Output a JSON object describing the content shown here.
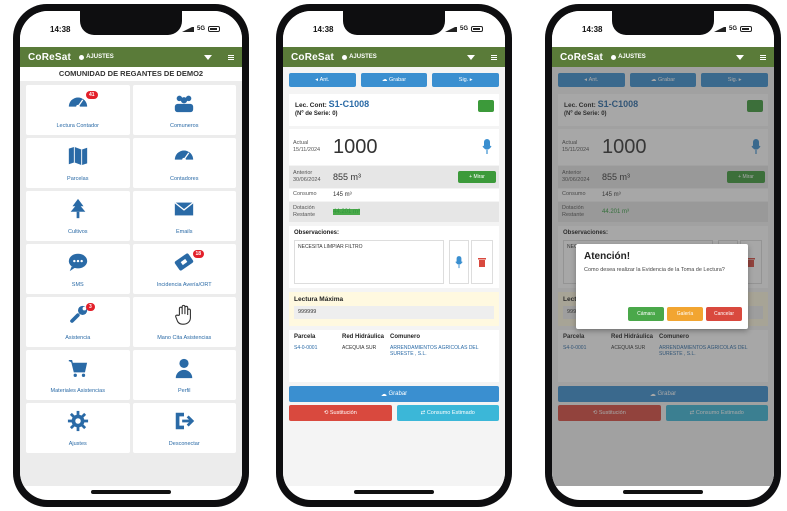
{
  "status": {
    "time": "14:38",
    "network": "5G"
  },
  "app": {
    "logo": "CoReSat",
    "settings_label": "AJUSTES"
  },
  "home": {
    "community": "COMUNIDAD DE REGANTES DE DEMO2",
    "tiles": [
      {
        "label": "Lectura Contador",
        "icon": "gauge-icon",
        "badge": "41"
      },
      {
        "label": "Comuneros",
        "icon": "people-icon",
        "badge": ""
      },
      {
        "label": "Parcelas",
        "icon": "map-icon",
        "badge": ""
      },
      {
        "label": "Contadores",
        "icon": "gauge-icon",
        "badge": ""
      },
      {
        "label": "Cultivos",
        "icon": "tree-icon",
        "badge": ""
      },
      {
        "label": "Emails",
        "icon": "envelope-icon",
        "badge": ""
      },
      {
        "label": "SMS",
        "icon": "chat-icon",
        "badge": ""
      },
      {
        "label": "Incidencia Avería/ORT",
        "icon": "ticket-icon",
        "badge": "18"
      },
      {
        "label": "Asistencia",
        "icon": "wrench-icon",
        "badge": "3"
      },
      {
        "label": "Mano Cita Asistencias",
        "icon": "hand-icon",
        "badge": ""
      },
      {
        "label": "Materiales Asistencias",
        "icon": "cart-icon",
        "badge": ""
      },
      {
        "label": "Perfil",
        "icon": "user-icon",
        "badge": ""
      },
      {
        "label": "Ajustes",
        "icon": "gear-icon",
        "badge": ""
      },
      {
        "label": "Desconectar",
        "icon": "logout-icon",
        "badge": ""
      }
    ]
  },
  "reading": {
    "tabs": {
      "prev": "Ant.",
      "save": "Grabar",
      "next": "Sig."
    },
    "counter_title": "Lec. Cont:",
    "counter_id": "S1-C1008",
    "serial": "(Nº de Serie: 0)",
    "current_label": "Actual",
    "current_date": "15/11/2024",
    "current_value": "1000",
    "previous_label": "Anterior",
    "previous_date": "30/06/2024",
    "previous_value": "855 m³",
    "more_button": "Mirar",
    "consumption_label": "Consumo",
    "consumption_value": "145 m³",
    "remaining_label": "Dotación Restante",
    "remaining_value": "44.201 m³",
    "obs_label": "Observaciones:",
    "obs_text": "NECESITA LIMPIAR FILTRO",
    "max_label": "Lectura Máxima",
    "max_value": "999999",
    "table_headers": [
      "Parcela",
      "Red Hidráulica",
      "Comunero"
    ],
    "table_row": [
      "S4-0-0001",
      "ACEQUIA SUR",
      "ARRENDAMIENTOS AGRICOLAS DEL SURESTE , S.L."
    ],
    "save_button": "Grabar",
    "replace_button": "Sustitución",
    "estimate_button": "Consumo Estimado"
  },
  "dialog": {
    "title": "Atención!",
    "message": "Como desea realizar la Evidencia de la Toma de Lectura?",
    "camera": "Cámara",
    "gallery": "Galería",
    "cancel": "Cancelar"
  },
  "colors": {
    "appbar": "#5a7b39",
    "primary": "#3a8fd0",
    "success": "#3c9a3a",
    "danger": "#d9493e",
    "info": "#3bb7d8"
  }
}
